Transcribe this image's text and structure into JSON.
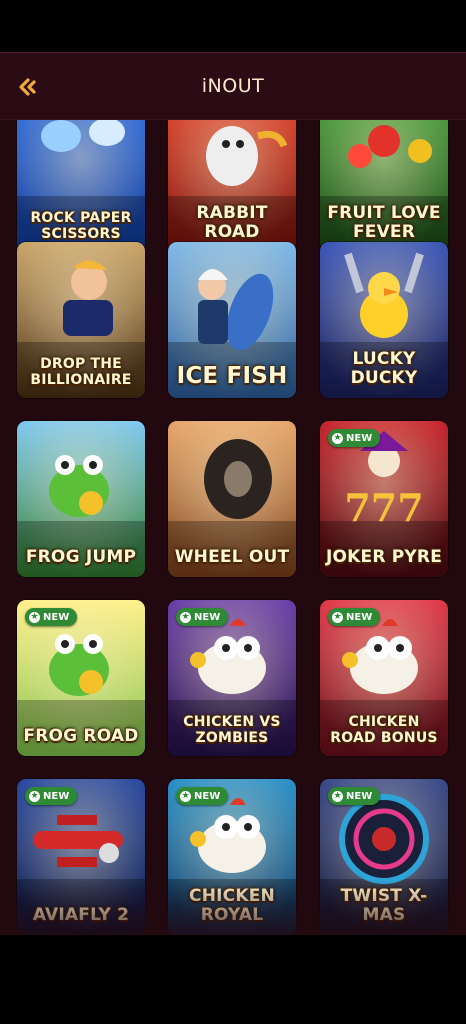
{
  "header": {
    "title": "iNOUT",
    "back_icon": "back-arrow-icon",
    "accent": "#f2a83b"
  },
  "badge_label": "NEW",
  "games": [
    {
      "title": "ROCK PAPER SCISSORS",
      "new": false,
      "bg": [
        "#2f6de0",
        "#103a9a"
      ],
      "icon": "hands-icon"
    },
    {
      "title": "RABBIT ROAD",
      "new": false,
      "bg": [
        "#e0422a",
        "#7a120c"
      ],
      "icon": "rabbit-icon"
    },
    {
      "title": "FRUIT LOVE FEVER",
      "new": false,
      "bg": [
        "#4aa13b",
        "#1b4a16"
      ],
      "icon": "fruit-icon"
    },
    {
      "title": "DROP THE BILLIONAIRE",
      "new": false,
      "bg": [
        "#caa56a",
        "#4a2e12"
      ],
      "icon": "man-icon"
    },
    {
      "title": "ICE FISH",
      "new": false,
      "bg": [
        "#7fb8e8",
        "#2c5e9a"
      ],
      "icon": "fish-icon"
    },
    {
      "title": "LUCKY DUCKY",
      "new": false,
      "bg": [
        "#3a56b8",
        "#1a1f5a"
      ],
      "icon": "duck-icon"
    },
    {
      "title": "FROG JUMP",
      "new": false,
      "bg": [
        "#7ec9f0",
        "#2f7a2a"
      ],
      "icon": "frog-icon"
    },
    {
      "title": "WHEEL OUT",
      "new": false,
      "bg": [
        "#e7a76b",
        "#7a3f1a"
      ],
      "icon": "tire-icon"
    },
    {
      "title": "JOKER PYRE",
      "new": true,
      "bg": [
        "#c8262e",
        "#4a0a10"
      ],
      "icon": "joker-icon"
    },
    {
      "title": "FROG ROAD",
      "new": true,
      "bg": [
        "#fff08a",
        "#7dc24a"
      ],
      "icon": "frog-icon"
    },
    {
      "title": "CHICKEN VS ZOMBIES",
      "new": true,
      "bg": [
        "#6a3fa8",
        "#25104a"
      ],
      "icon": "chicken-icon"
    },
    {
      "title": "CHICKEN ROAD BONUS",
      "new": true,
      "bg": [
        "#e03a4a",
        "#6a0f1a"
      ],
      "icon": "chicken-icon"
    },
    {
      "title": "AVIAFLY 2",
      "new": true,
      "bg": [
        "#2a4aa0",
        "#0e1a4a"
      ],
      "icon": "plane-icon"
    },
    {
      "title": "CHICKEN ROYAL",
      "new": true,
      "bg": [
        "#2a90c8",
        "#0e3a6a"
      ],
      "icon": "chicken-icon"
    },
    {
      "title": "TWIST X-MAS",
      "new": true,
      "bg": [
        "#3a4a8a",
        "#141a3a"
      ],
      "icon": "wheel-icon"
    }
  ]
}
